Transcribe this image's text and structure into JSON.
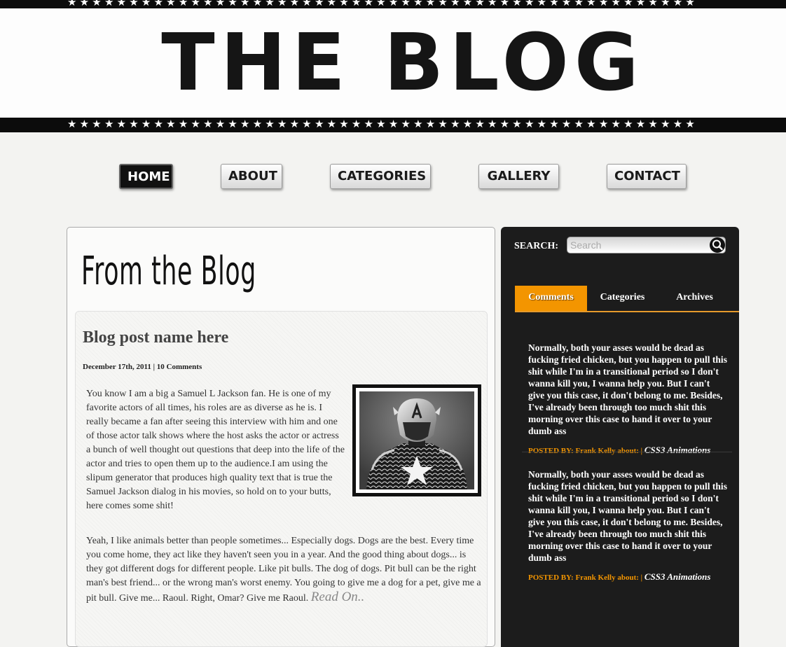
{
  "header": {
    "title": "THE BLOG",
    "stars": "★★★★★★★★★★★★★★★★★★★★★★★★★★★★★★★★★★★★★★★★★★★★★★★★★★★"
  },
  "nav": {
    "items": [
      {
        "label": "HOME",
        "active": true
      },
      {
        "label": "ABOUT",
        "active": false
      },
      {
        "label": "CATEGORIES",
        "active": false
      },
      {
        "label": "GALLERY",
        "active": false
      },
      {
        "label": "CONTACT",
        "active": false
      }
    ]
  },
  "main": {
    "section_title": "From the Blog",
    "post": {
      "title": "Blog post name here",
      "meta": "December 17th, 2011 | 10 Comments",
      "body": "You know I am a big a Samuel L Jackson fan. He is one of my favorite actors of all times, his roles are as diverse as he is. I really became a fan after seeing this interview with him and one of those actor talk shows where the host asks the actor or actress a bunch of well thought out questions that deep into the life of the actor and tries to open them up to the audience.I am using the slipum generator that produces high quality text that is true the Samuel Jackson dialog in his movies, so hold on to your butts, here comes some shit!",
      "body2": "Yeah, I like animals better than people sometimes... Especially dogs. Dogs are the best. Every time you come home, they act like they haven't seen you in a year. And the good thing about dogs... is they got different dogs for different people. Like pit bulls. The dog of dogs. Pit bull can be the right man's best friend... or the wrong man's worst enemy. You going to give me a dog for a pet, give me a pit bull. Give me... Raoul. Right, Omar? Give me Raoul.",
      "read_on": "Read On.."
    }
  },
  "sidebar": {
    "search_label": "SEARCH:",
    "search_placeholder": "Search",
    "search_value": "",
    "tabs": [
      "Comments",
      "Categories",
      "Archives"
    ],
    "active_tab": "Comments",
    "comments": [
      {
        "text": "Normally, both your asses would be dead as fucking fried chicken, but you happen to pull this shit while I'm in a transitional period so I don't wanna kill you, I wanna help you. But I can't give you this case, it don't belong to me. Besides, I've already been through too much shit this morning over this case to hand it over to your dumb ass",
        "posted_by": "POSTED BY: Frank Kelly about:",
        "separator": "|",
        "topic": "CSS3 Animations"
      },
      {
        "text": "Normally, both your asses would be dead as fucking fried chicken, but you happen to pull this shit while I'm in a transitional period so I don't wanna kill you, I wanna help you. But I can't give you this case, it don't belong to me. Besides, I've already been through too much shit this morning over this case to hand it over to your dumb ass",
        "posted_by": "POSTED BY: Frank Kelly about:",
        "separator": "|",
        "topic": "CSS3 Animations"
      }
    ]
  },
  "colors": {
    "accent": "#f39500",
    "sidebar_bg": "#1c1c1c",
    "band": "#0c0c0c"
  },
  "icons": {
    "search": "magnifier-icon",
    "post_image": "superhero-image"
  }
}
